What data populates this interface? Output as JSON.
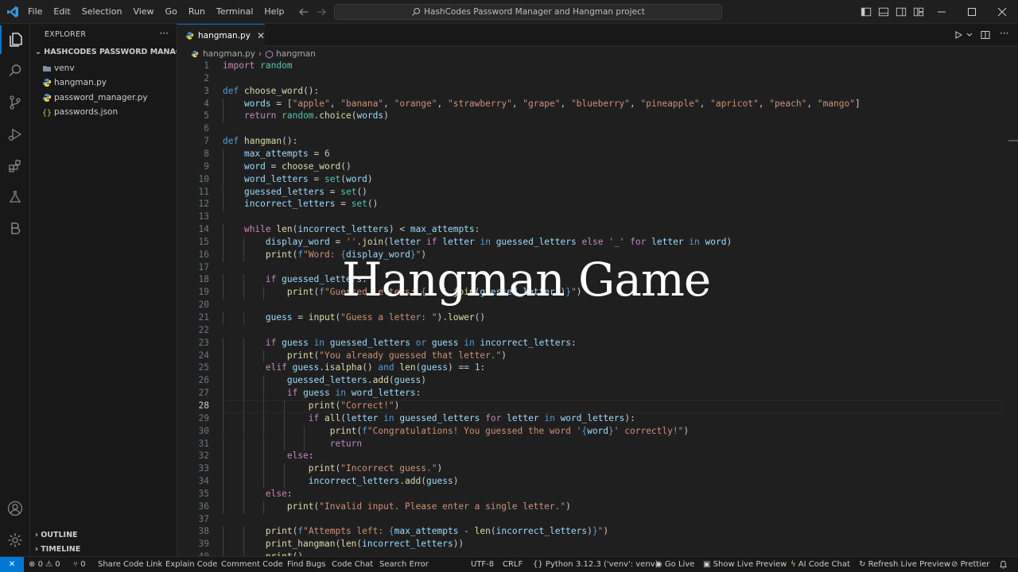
{
  "menu": [
    "File",
    "Edit",
    "Selection",
    "View",
    "Go",
    "Run",
    "Terminal",
    "Help"
  ],
  "search_text": "HashCodes Password Manager and Hangman project",
  "explorer": {
    "header": "EXPLORER",
    "more": "···",
    "folder": "HASHCODES PASSWORD MANAGER...",
    "files": [
      {
        "name": "venv",
        "icon": "folder-icon"
      },
      {
        "name": "hangman.py",
        "icon": "python-file-icon"
      },
      {
        "name": "password_manager.py",
        "icon": "python-file-icon"
      },
      {
        "name": "passwords.json",
        "icon": "json-file-icon"
      }
    ],
    "outline": "OUTLINE",
    "timeline": "TIMELINE"
  },
  "tab": {
    "label": "hangman.py",
    "close": "✕"
  },
  "breadcrumb": {
    "file": "hangman.py",
    "sep": "›",
    "symbol": "hangman"
  },
  "overlay_title": "Hangman Game",
  "code": {
    "current_line": 28,
    "lines": [
      [
        [
          "import",
          "ctl"
        ],
        [
          " "
        ],
        [
          "random",
          "mod"
        ]
      ],
      [],
      [
        [
          "def",
          "kw"
        ],
        [
          " "
        ],
        [
          "choose_word",
          "fn"
        ],
        [
          "():"
        ]
      ],
      [
        [
          "    "
        ],
        [
          "words",
          "var"
        ],
        [
          " = ["
        ],
        [
          "\"apple\"",
          "str"
        ],
        [
          ", "
        ],
        [
          "\"banana\"",
          "str"
        ],
        [
          ", "
        ],
        [
          "\"orange\"",
          "str"
        ],
        [
          ", "
        ],
        [
          "\"strawberry\"",
          "str"
        ],
        [
          ", "
        ],
        [
          "\"grape\"",
          "str"
        ],
        [
          ", "
        ],
        [
          "\"blueberry\"",
          "str"
        ],
        [
          ", "
        ],
        [
          "\"pineapple\"",
          "str"
        ],
        [
          ", "
        ],
        [
          "\"apricot\"",
          "str"
        ],
        [
          ", "
        ],
        [
          "\"peach\"",
          "str"
        ],
        [
          ", "
        ],
        [
          "\"mango\"",
          "str"
        ],
        [
          "]"
        ]
      ],
      [
        [
          "    "
        ],
        [
          "return",
          "ctl"
        ],
        [
          " "
        ],
        [
          "random",
          "mod"
        ],
        [
          "."
        ],
        [
          "choice",
          "fn"
        ],
        [
          "("
        ],
        [
          "words",
          "var"
        ],
        [
          ")"
        ]
      ],
      [],
      [
        [
          "def",
          "kw"
        ],
        [
          " "
        ],
        [
          "hangman",
          "fn"
        ],
        [
          "():"
        ]
      ],
      [
        [
          "    "
        ],
        [
          "max_attempts",
          "var"
        ],
        [
          " = "
        ],
        [
          "6",
          "num"
        ]
      ],
      [
        [
          "    "
        ],
        [
          "word",
          "var"
        ],
        [
          " = "
        ],
        [
          "choose_word",
          "fn"
        ],
        [
          "()"
        ]
      ],
      [
        [
          "    "
        ],
        [
          "word_letters",
          "var"
        ],
        [
          " = "
        ],
        [
          "set",
          "mod"
        ],
        [
          "("
        ],
        [
          "word",
          "var"
        ],
        [
          ")"
        ]
      ],
      [
        [
          "    "
        ],
        [
          "guessed_letters",
          "var"
        ],
        [
          " = "
        ],
        [
          "set",
          "mod"
        ],
        [
          "()"
        ]
      ],
      [
        [
          "    "
        ],
        [
          "incorrect_letters",
          "var"
        ],
        [
          " = "
        ],
        [
          "set",
          "mod"
        ],
        [
          "()"
        ]
      ],
      [],
      [
        [
          "    "
        ],
        [
          "while",
          "ctl"
        ],
        [
          " "
        ],
        [
          "len",
          "fn"
        ],
        [
          "("
        ],
        [
          "incorrect_letters",
          "var"
        ],
        [
          ") < "
        ],
        [
          "max_attempts",
          "var"
        ],
        [
          ":"
        ]
      ],
      [
        [
          "        "
        ],
        [
          "display_word",
          "var"
        ],
        [
          " = "
        ],
        [
          "''",
          "str"
        ],
        [
          "."
        ],
        [
          "join",
          "fn"
        ],
        [
          "("
        ],
        [
          "letter",
          "var"
        ],
        [
          " "
        ],
        [
          "if",
          "ctl"
        ],
        [
          " "
        ],
        [
          "letter",
          "var"
        ],
        [
          " "
        ],
        [
          "in",
          "kw"
        ],
        [
          " "
        ],
        [
          "guessed_letters",
          "var"
        ],
        [
          " "
        ],
        [
          "else",
          "ctl"
        ],
        [
          " "
        ],
        [
          "'_'",
          "str"
        ],
        [
          " "
        ],
        [
          "for",
          "ctl"
        ],
        [
          " "
        ],
        [
          "letter",
          "var"
        ],
        [
          " "
        ],
        [
          "in",
          "kw"
        ],
        [
          " "
        ],
        [
          "word",
          "var"
        ],
        [
          ")"
        ]
      ],
      [
        [
          "        "
        ],
        [
          "print",
          "fn"
        ],
        [
          "("
        ],
        [
          "f",
          "kw"
        ],
        [
          "\"Word: ",
          "str"
        ],
        [
          "{",
          "brc"
        ],
        [
          "display_word",
          "var"
        ],
        [
          "}",
          "brc"
        ],
        [
          "\"",
          "str"
        ],
        [
          ")"
        ]
      ],
      [],
      [
        [
          "        "
        ],
        [
          "if",
          "ctl"
        ],
        [
          " "
        ],
        [
          "guessed_letters",
          "var"
        ],
        [
          ":"
        ]
      ],
      [
        [
          "            "
        ],
        [
          "print",
          "fn"
        ],
        [
          "("
        ],
        [
          "f",
          "kw"
        ],
        [
          "\"Guessed letters: ",
          "str"
        ],
        [
          "{",
          "brc"
        ],
        [
          "', '",
          "str"
        ],
        [
          "."
        ],
        [
          "join",
          "fn"
        ],
        [
          "("
        ],
        [
          "guessed_letters",
          "var"
        ],
        [
          ")"
        ],
        [
          "}",
          "brc"
        ],
        [
          "\"",
          "str"
        ],
        [
          ")"
        ]
      ],
      [],
      [
        [
          "        "
        ],
        [
          "guess",
          "var"
        ],
        [
          " = "
        ],
        [
          "input",
          "fn"
        ],
        [
          "("
        ],
        [
          "\"Guess a letter: \"",
          "str"
        ],
        [
          ")."
        ],
        [
          "lower",
          "fn"
        ],
        [
          "()"
        ]
      ],
      [],
      [
        [
          "        "
        ],
        [
          "if",
          "ctl"
        ],
        [
          " "
        ],
        [
          "guess",
          "var"
        ],
        [
          " "
        ],
        [
          "in",
          "kw"
        ],
        [
          " "
        ],
        [
          "guessed_letters",
          "var"
        ],
        [
          " "
        ],
        [
          "or",
          "kw"
        ],
        [
          " "
        ],
        [
          "guess",
          "var"
        ],
        [
          " "
        ],
        [
          "in",
          "kw"
        ],
        [
          " "
        ],
        [
          "incorrect_letters",
          "var"
        ],
        [
          ":"
        ]
      ],
      [
        [
          "            "
        ],
        [
          "print",
          "fn"
        ],
        [
          "("
        ],
        [
          "\"You already guessed that letter.\"",
          "str"
        ],
        [
          ")"
        ]
      ],
      [
        [
          "        "
        ],
        [
          "elif",
          "ctl"
        ],
        [
          " "
        ],
        [
          "guess",
          "var"
        ],
        [
          "."
        ],
        [
          "isalpha",
          "fn"
        ],
        [
          "() "
        ],
        [
          "and",
          "kw"
        ],
        [
          " "
        ],
        [
          "len",
          "fn"
        ],
        [
          "("
        ],
        [
          "guess",
          "var"
        ],
        [
          ") == "
        ],
        [
          "1",
          "num"
        ],
        [
          ":"
        ]
      ],
      [
        [
          "            "
        ],
        [
          "guessed_letters",
          "var"
        ],
        [
          "."
        ],
        [
          "add",
          "fn"
        ],
        [
          "("
        ],
        [
          "guess",
          "var"
        ],
        [
          ")"
        ]
      ],
      [
        [
          "            "
        ],
        [
          "if",
          "ctl"
        ],
        [
          " "
        ],
        [
          "guess",
          "var"
        ],
        [
          " "
        ],
        [
          "in",
          "kw"
        ],
        [
          " "
        ],
        [
          "word_letters",
          "var"
        ],
        [
          ":"
        ]
      ],
      [
        [
          "                "
        ],
        [
          "print",
          "fn"
        ],
        [
          "("
        ],
        [
          "\"Correct!\"",
          "str"
        ],
        [
          ")"
        ]
      ],
      [
        [
          "                "
        ],
        [
          "if",
          "ctl"
        ],
        [
          " "
        ],
        [
          "all",
          "fn"
        ],
        [
          "("
        ],
        [
          "letter",
          "var"
        ],
        [
          " "
        ],
        [
          "in",
          "kw"
        ],
        [
          " "
        ],
        [
          "guessed_letters",
          "var"
        ],
        [
          " "
        ],
        [
          "for",
          "ctl"
        ],
        [
          " "
        ],
        [
          "letter",
          "var"
        ],
        [
          " "
        ],
        [
          "in",
          "kw"
        ],
        [
          " "
        ],
        [
          "word_letters",
          "var"
        ],
        [
          "):"
        ]
      ],
      [
        [
          "                    "
        ],
        [
          "print",
          "fn"
        ],
        [
          "("
        ],
        [
          "f",
          "kw"
        ],
        [
          "\"Congratulations! You guessed the word '",
          "str"
        ],
        [
          "{",
          "brc"
        ],
        [
          "word",
          "var"
        ],
        [
          "}",
          "brc"
        ],
        [
          "' correctly!\"",
          "str"
        ],
        [
          ")"
        ]
      ],
      [
        [
          "                    "
        ],
        [
          "return",
          "ctl"
        ]
      ],
      [
        [
          "            "
        ],
        [
          "else",
          "ctl"
        ],
        [
          ":"
        ]
      ],
      [
        [
          "                "
        ],
        [
          "print",
          "fn"
        ],
        [
          "("
        ],
        [
          "\"Incorrect guess.\"",
          "str"
        ],
        [
          ")"
        ]
      ],
      [
        [
          "                "
        ],
        [
          "incorrect_letters",
          "var"
        ],
        [
          "."
        ],
        [
          "add",
          "fn"
        ],
        [
          "("
        ],
        [
          "guess",
          "var"
        ],
        [
          ")"
        ]
      ],
      [
        [
          "        "
        ],
        [
          "else",
          "ctl"
        ],
        [
          ":"
        ]
      ],
      [
        [
          "            "
        ],
        [
          "print",
          "fn"
        ],
        [
          "("
        ],
        [
          "\"Invalid input. Please enter a single letter.\"",
          "str"
        ],
        [
          ")"
        ]
      ],
      [],
      [
        [
          "        "
        ],
        [
          "print",
          "fn"
        ],
        [
          "("
        ],
        [
          "f",
          "kw"
        ],
        [
          "\"Attempts left: ",
          "str"
        ],
        [
          "{",
          "brc"
        ],
        [
          "max_attempts",
          "var"
        ],
        [
          " - "
        ],
        [
          "len",
          "fn"
        ],
        [
          "("
        ],
        [
          "incorrect_letters",
          "var"
        ],
        [
          ")"
        ],
        [
          "}",
          "brc"
        ],
        [
          "\"",
          "str"
        ],
        [
          ")"
        ]
      ],
      [
        [
          "        "
        ],
        [
          "print_hangman",
          "fn"
        ],
        [
          "("
        ],
        [
          "len",
          "fn"
        ],
        [
          "("
        ],
        [
          "incorrect_letters",
          "var"
        ],
        [
          "))"
        ]
      ],
      [
        [
          "        "
        ],
        [
          "print",
          "fn"
        ],
        [
          "()"
        ]
      ]
    ]
  },
  "statusbar": {
    "remote": "✕",
    "errors": "0",
    "warnings": "0",
    "ports": "0",
    "left_items": [
      "Share Code Link",
      "Explain Code",
      "Comment Code",
      "Find Bugs",
      "Code Chat",
      "Search Error"
    ],
    "encoding": "UTF-8",
    "eol": "CRLF",
    "language": "Python",
    "interpreter": "3.12.3 ('venv': venv)",
    "go_live": "Go Live",
    "show_live_preview": "Show Live Preview",
    "ai_code_chat": "AI Code Chat",
    "refresh_live_preview": "Refresh Live Preview",
    "prettier": "Prettier"
  },
  "colors": {
    "accent": "#0078d4",
    "editor_bg": "#1f1f1f",
    "sidebar_bg": "#181818"
  }
}
